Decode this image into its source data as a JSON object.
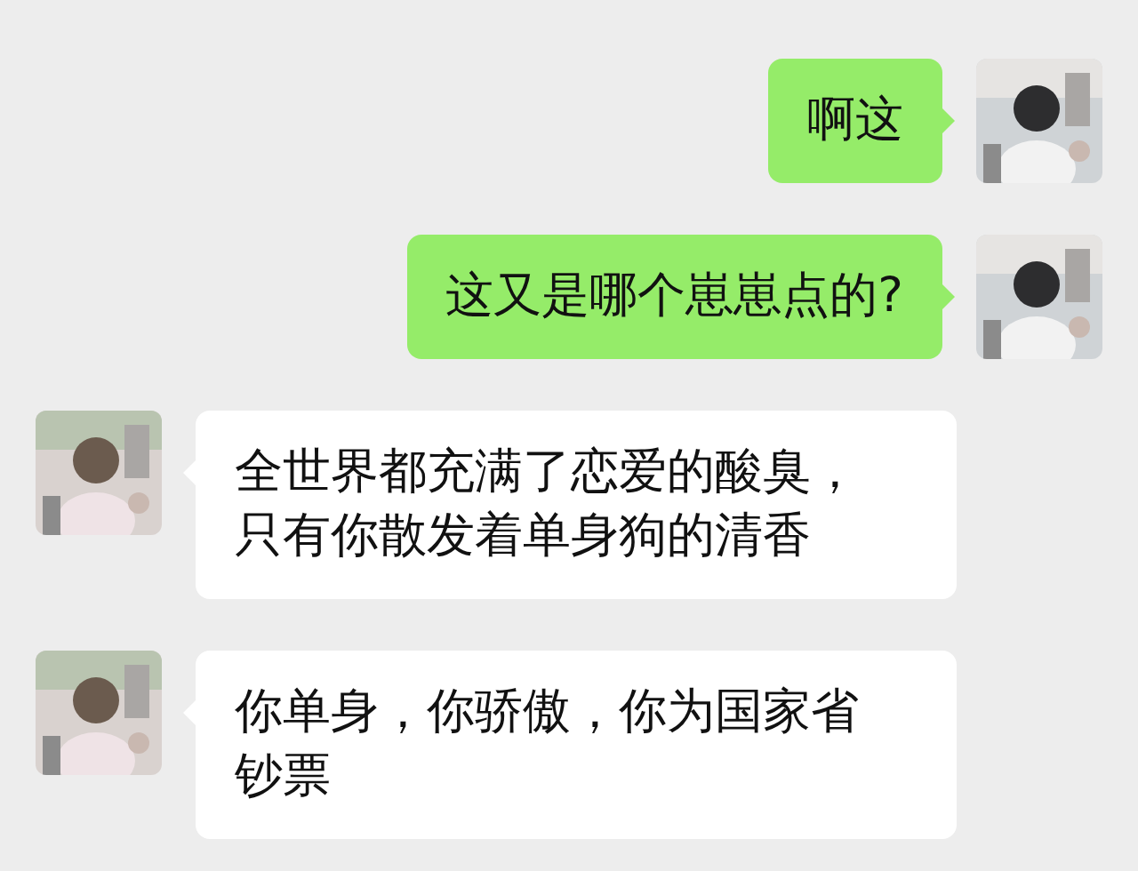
{
  "messages": [
    {
      "kind": "outgoing",
      "avatar": {
        "kind": "picture"
      },
      "lines": [
        "啊这"
      ]
    },
    {
      "kind": "outgoing",
      "avatar": {
        "kind": "picture"
      },
      "lines": [
        "这又是哪个崽崽点的?"
      ]
    },
    {
      "kind": "incoming",
      "avatar": {
        "kind": "picture"
      },
      "lines": [
        "全世界都充满了恋爱的酸臭，",
        "只有你散发着单身狗的清香"
      ]
    },
    {
      "kind": "incoming",
      "avatar": {
        "kind": "picture"
      },
      "lines": [
        "你单身，你骄傲，你为国家省",
        "钞票"
      ]
    }
  ]
}
